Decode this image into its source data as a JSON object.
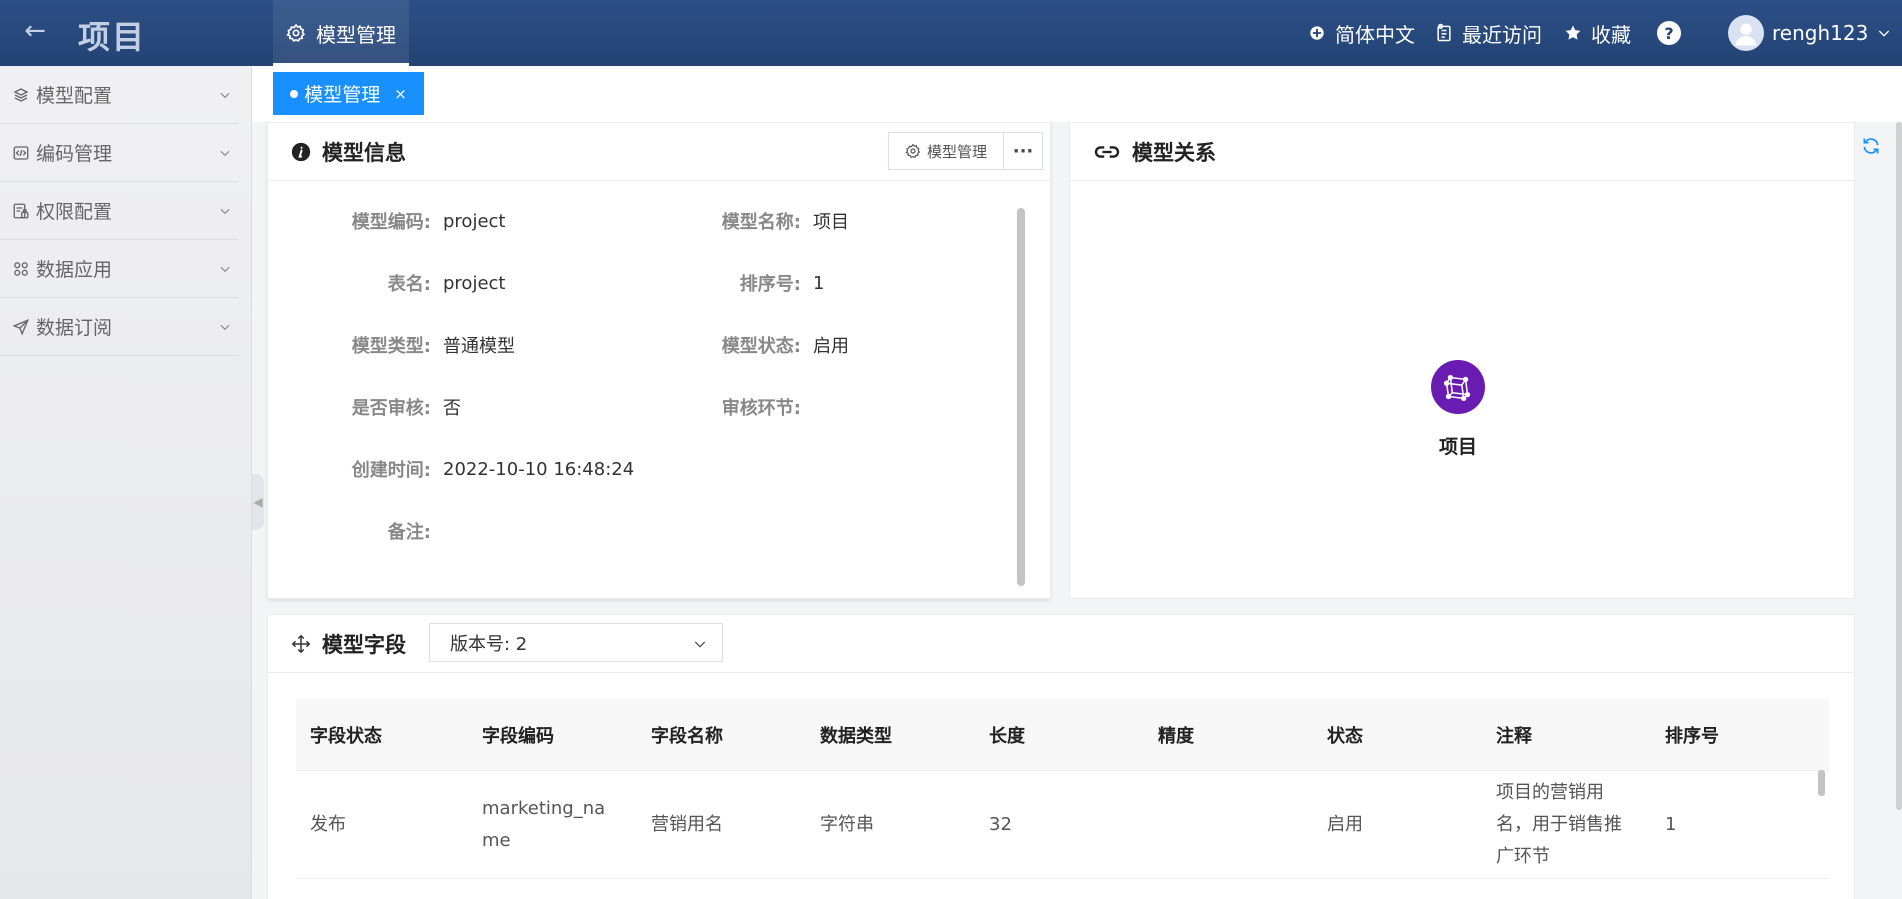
{
  "header": {
    "back_icon": "arrow-left-icon",
    "title": "项目",
    "nav_tab": "模型管理",
    "language": "简体中文",
    "recent": "最近访问",
    "favorites": "收藏",
    "help": "?",
    "username": "rengh123"
  },
  "sidebar": {
    "items": [
      {
        "label": "模型配置",
        "icon": "layers-icon"
      },
      {
        "label": "编码管理",
        "icon": "code-icon"
      },
      {
        "label": "权限配置",
        "icon": "permission-icon"
      },
      {
        "label": "数据应用",
        "icon": "apps-icon"
      },
      {
        "label": "数据订阅",
        "icon": "send-icon"
      }
    ]
  },
  "tabs": {
    "active": "模型管理",
    "close": "×"
  },
  "model_info": {
    "title": "模型信息",
    "manage_button": "模型管理",
    "more_button": "···",
    "fields": {
      "code_label": "模型编码:",
      "code_value": "project",
      "name_label": "模型名称:",
      "name_value": "项目",
      "table_label": "表名:",
      "table_value": "project",
      "sort_label": "排序号:",
      "sort_value": "1",
      "type_label": "模型类型:",
      "type_value": "普通模型",
      "status_label": "模型状态:",
      "status_value": "启用",
      "audit_label": "是否审核:",
      "audit_value": "否",
      "audit_step_label": "审核环节:",
      "audit_step_value": "",
      "created_label": "创建时间:",
      "created_value": "2022-10-10 16:48:24",
      "remark_label": "备注:",
      "remark_value": ""
    }
  },
  "model_relation": {
    "title": "模型关系",
    "node_label": "项目"
  },
  "model_fields": {
    "title": "模型字段",
    "version": "版本号: 2",
    "columns": [
      "字段状态",
      "字段编码",
      "字段名称",
      "数据类型",
      "长度",
      "精度",
      "状态",
      "注释",
      "排序号"
    ],
    "rows": [
      {
        "field_status": "发布",
        "field_code": "marketing_name",
        "field_name": "营销用名",
        "data_type": "字符串",
        "length": "32",
        "precision": "",
        "status": "启用",
        "comment": "项目的营销用名，用于销售推广环节",
        "sort": "1"
      }
    ]
  },
  "colors": {
    "header_bg": "#234374",
    "accent": "#1890ff",
    "node": "#6a1cb2"
  }
}
